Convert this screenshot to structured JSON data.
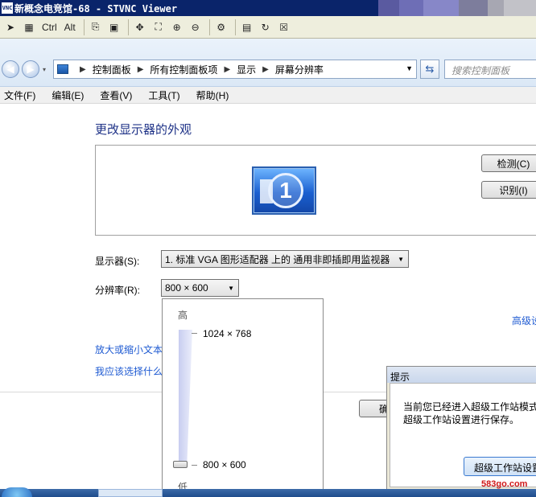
{
  "vnc": {
    "title": "新概念电竞馆-68 - STVNC Viewer",
    "title_bar_bands": [
      "#555599",
      "#6a6ab0",
      "#8c8ccc",
      "#7a7a9a",
      "#aaaab0",
      "#c4c4c8"
    ],
    "toolbar": {
      "ctrl_label": "Ctrl",
      "alt_label": "Alt"
    }
  },
  "explorer": {
    "breadcrumbs": [
      "控制面板",
      "所有控制面板项",
      "显示",
      "屏幕分辨率"
    ],
    "search_placeholder": "搜索控制面板",
    "menu": [
      "文件(F)",
      "编辑(E)",
      "查看(V)",
      "工具(T)",
      "帮助(H)"
    ]
  },
  "display": {
    "title": "更改显示器的外观",
    "monitor_number": "1",
    "detect_button": "检测(C)",
    "identify_button": "识别(I)",
    "display_label": "显示器(S):",
    "display_value": "1. 标准 VGA 图形适配器 上的 通用非即插即用监视器",
    "resolution_label": "分辨率(R):",
    "resolution_value": "800 × 600",
    "advanced_link": "高级设",
    "link_text_size": "放大或缩小文本",
    "link_which_settings": "我应该选择什么",
    "ok_button_partial": "确"
  },
  "resolution_popup": {
    "high_label": "高",
    "low_label": "低",
    "max_resolution": "1024 × 768",
    "min_resolution": "800 × 600"
  },
  "dialog": {
    "title": "提示",
    "message_line1": "当前您已经进入超级工作站模式",
    "message_line2": "超级工作站设置进行保存。",
    "button_label": "超级工作站设置"
  },
  "watermark": "583go.com"
}
